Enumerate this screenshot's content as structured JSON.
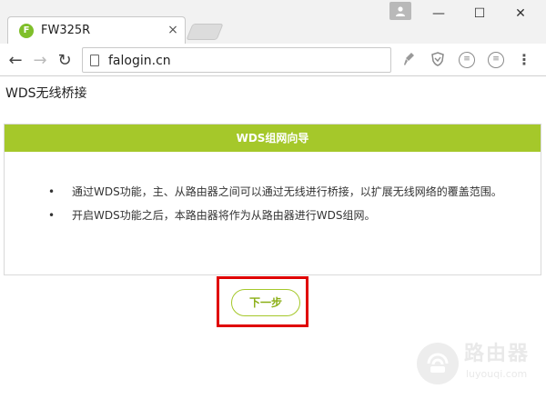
{
  "browser": {
    "tab_title": "FW325R",
    "tab_favicon_letter": "F",
    "close_tab_glyph": "×",
    "url": "falogin.cn",
    "window_controls": {
      "minimize": "—",
      "maximize": "☐",
      "close": "✕"
    },
    "nav": {
      "back": "←",
      "forward": "→",
      "reload": "↻"
    },
    "menu_glyph": "⋮"
  },
  "page": {
    "title": "WDS无线桥接",
    "panel_header": "WDS组网向导",
    "bullets": [
      "通过WDS功能，主、从路由器之间可以通过无线进行桥接，以扩展无线网络的覆盖范围。",
      "开启WDS功能之后，本路由器将作为从路由器进行WDS组网。"
    ],
    "next_button": "下一步"
  },
  "watermark": {
    "cn": "路由器",
    "en": "luyouqi.com"
  },
  "colors": {
    "accent_green": "#a5c82a",
    "highlight_red": "#e00000"
  }
}
